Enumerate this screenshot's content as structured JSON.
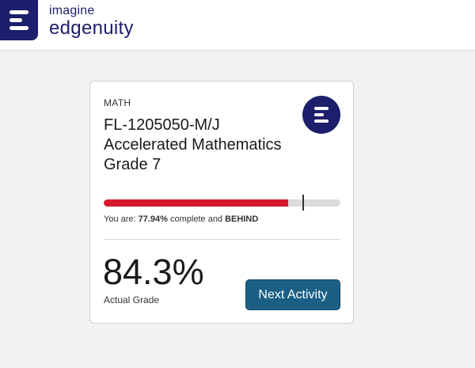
{
  "brand": {
    "line1": "imagine",
    "line2": "edgenuity",
    "logo_icon": "edgenuity-logo-icon",
    "color": "#1c1f6b"
  },
  "course": {
    "subject": "MATH",
    "title": "FL-1205050-M/J Accelerated Mathematics Grade 7",
    "icon": "edgenuity-course-icon",
    "progress": {
      "percent_complete": 77.94,
      "target_percent": 84,
      "status_prefix": "You are: ",
      "percent_text": "77.94%",
      "status_middle": " complete and ",
      "status_word": "BEHIND",
      "fill_color": "#d7192d",
      "track_color": "#dcdcdc"
    },
    "grade": {
      "value": "84.3%",
      "label": "Actual Grade"
    },
    "next_button_label": "Next Activity",
    "button_color": "#1b5f85"
  }
}
